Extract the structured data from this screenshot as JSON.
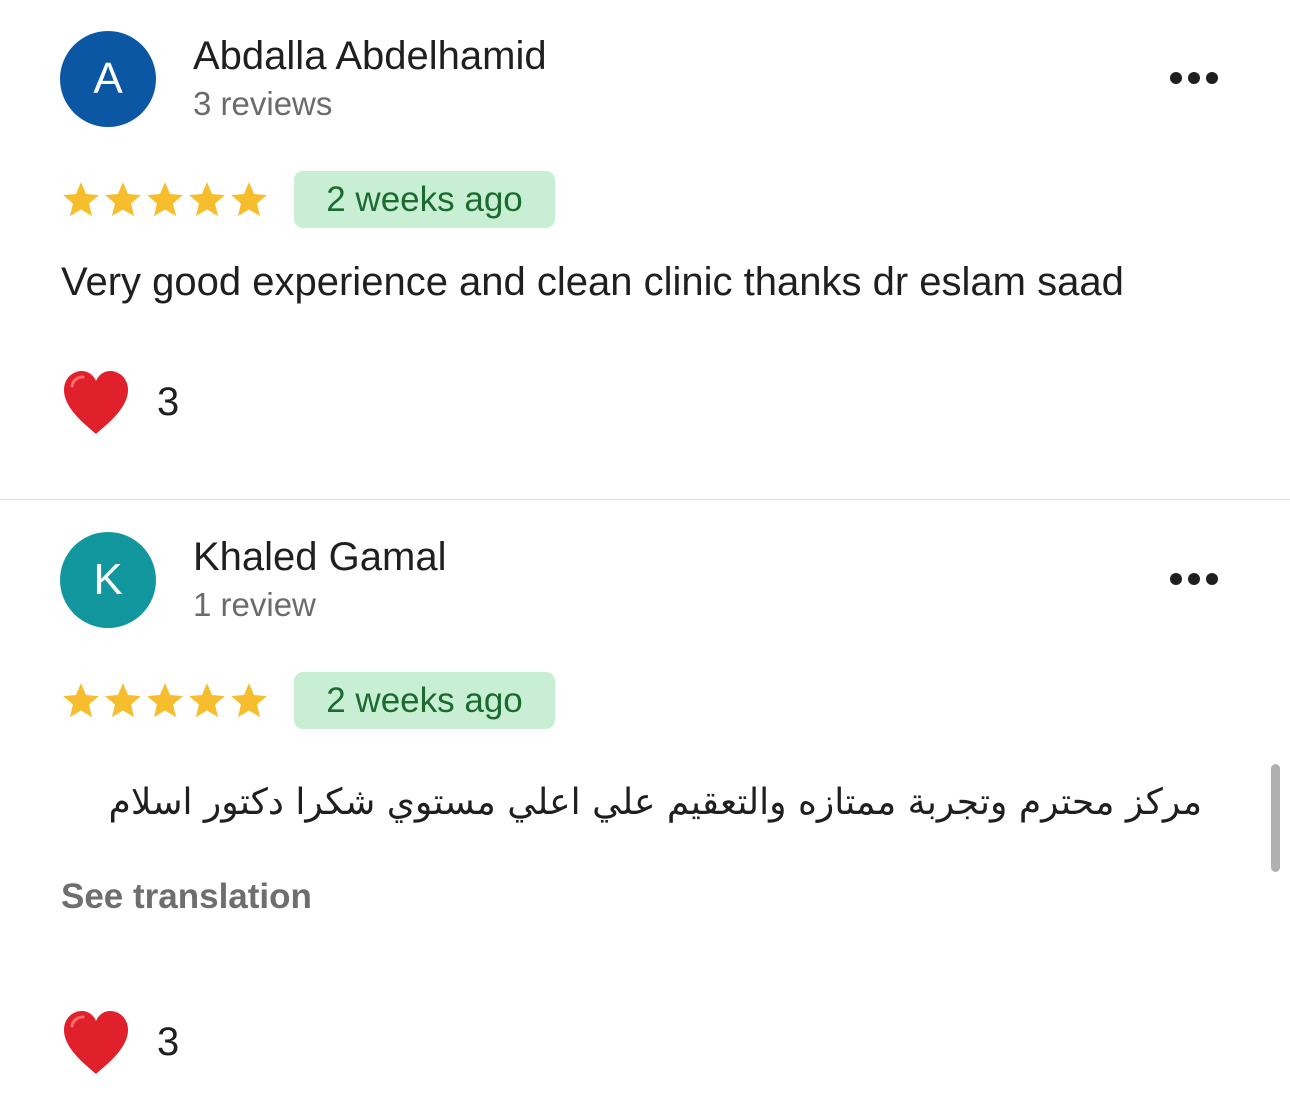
{
  "colors": {
    "star": "#F6BE2C",
    "time_badge_bg": "#C8EFD4",
    "time_badge_text": "#1B6B30",
    "heart": "#E0202B"
  },
  "reviews": [
    {
      "initial": "A",
      "avatar_color": "#0B57A3",
      "name": "Abdalla Abdelhamid",
      "review_count": "3 reviews",
      "rating": 5,
      "time": "2 weeks ago",
      "text": "Very good experience and clean clinic thanks dr eslam saad",
      "reaction_icon": "red-heart-icon",
      "reaction_count": "3"
    },
    {
      "initial": "K",
      "avatar_color": "#13979E",
      "name": "Khaled Gamal",
      "review_count": "1 review",
      "rating": 5,
      "time": "2 weeks ago",
      "text": "مركز محترم وتجربة ممتازه والتعقيم علي اعلي مستوي شكرا دكتور اسلام",
      "translate_label": "See translation",
      "reaction_icon": "red-heart-icon",
      "reaction_count": "3"
    }
  ]
}
